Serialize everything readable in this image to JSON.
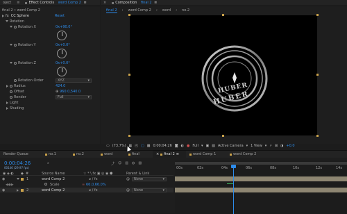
{
  "left_tabs": {
    "project": "oject",
    "effect_controls": "Effect Controls",
    "effect_comp": "word Comp 2",
    "menu": "≡"
  },
  "effect": {
    "breadcrumb": "final 2 • word Comp 2",
    "fx": "fx",
    "name": "CC Sphere",
    "reset": "Reset",
    "rotation": "Rotation",
    "rot_x_label": "Rotation X",
    "rot_x_value": "0x+90.0°",
    "rot_y_label": "Rotation Y",
    "rot_y_value": "0x+0.0°",
    "rot_z_label": "Rotation Z",
    "rot_z_value": "0x+0.0°",
    "rot_order_label": "Rotation Order",
    "rot_order_value": "XYZ",
    "radius_label": "Radius",
    "radius_value": "424.0",
    "offset_label": "Offset",
    "offset_value": "960.0,540.0",
    "render_label": "Render",
    "render_value": "Full",
    "light": "Light",
    "shading": "Shading"
  },
  "comp": {
    "tab_label": "Composition",
    "tab_comp": "final 2",
    "breadcrumbs": [
      "final 2",
      "word Comp 2",
      "word",
      "no.2"
    ],
    "logo_text_top": "HUBER",
    "logo_text_bottom": "HUBER"
  },
  "viewer_toolbar": {
    "zoom": "(73.7%)",
    "timecode": "0:00:04:26",
    "resolution": "Full",
    "camera": "Active Camera",
    "views": "1 View",
    "exposure": "+0.0"
  },
  "timeline": {
    "tabs": [
      "Render Queue",
      "no.1",
      "no.2",
      "word",
      "final",
      "final 2",
      "word Comp 1",
      "word Comp 2"
    ],
    "active_tab": "final 2",
    "timecode": "0:00:04:26",
    "frames": "00146 (29.97 fps)",
    "col_num": "#",
    "col_source": "Source Name",
    "col_parent": "Parent & Link",
    "layers": [
      {
        "num": "1",
        "name": "word Comp 2",
        "parent": "None"
      },
      {
        "sub": "Scale",
        "value": "66.0,66.0%"
      },
      {
        "num": "2",
        "name": "word Comp 2",
        "parent": "None"
      }
    ],
    "ruler": [
      "00s",
      "02s",
      "04s",
      "06s",
      "08s",
      "10s",
      "12s",
      "14s"
    ]
  },
  "colors": {
    "accent": "#2d8ceb",
    "label_tan": "#c9a14a",
    "bg": "#1c1c1c"
  }
}
